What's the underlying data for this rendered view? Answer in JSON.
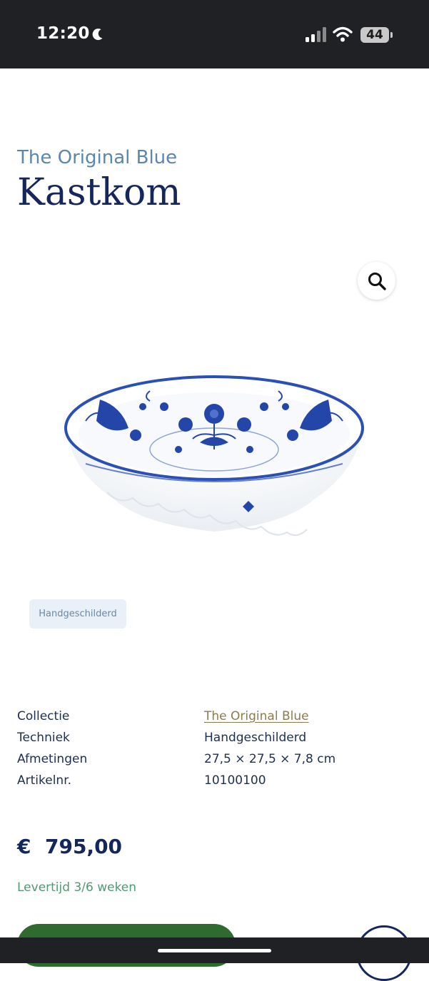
{
  "status_bar": {
    "time": "12:20",
    "battery": "44",
    "icons": [
      "moon-icon",
      "signal-icon",
      "wifi-icon",
      "battery-icon"
    ]
  },
  "product": {
    "collection": "The Original Blue",
    "title": "Kastkom",
    "tag": "Handgeschilderd",
    "image_icon": "delft-blue-bowl"
  },
  "specs": [
    {
      "label": "Collectie",
      "value": "The Original Blue"
    },
    {
      "label": "Techniek",
      "value": "Handgeschilderd"
    },
    {
      "label": "Afmetingen",
      "value": "27,5 × 27,5 × 7,8 cm"
    },
    {
      "label": "Artikelnr.",
      "value": "10100100"
    }
  ],
  "price": "€  795,00",
  "delivery": "Levertijd 3/6 weken",
  "colors": {
    "navy": "#14265b",
    "subtitle_blue": "#5d86ad",
    "delivery_green": "#4f9a73",
    "cart_green": "#2f6a2f",
    "link_gold": "#8d7a4f",
    "status_bar": "#202124"
  }
}
